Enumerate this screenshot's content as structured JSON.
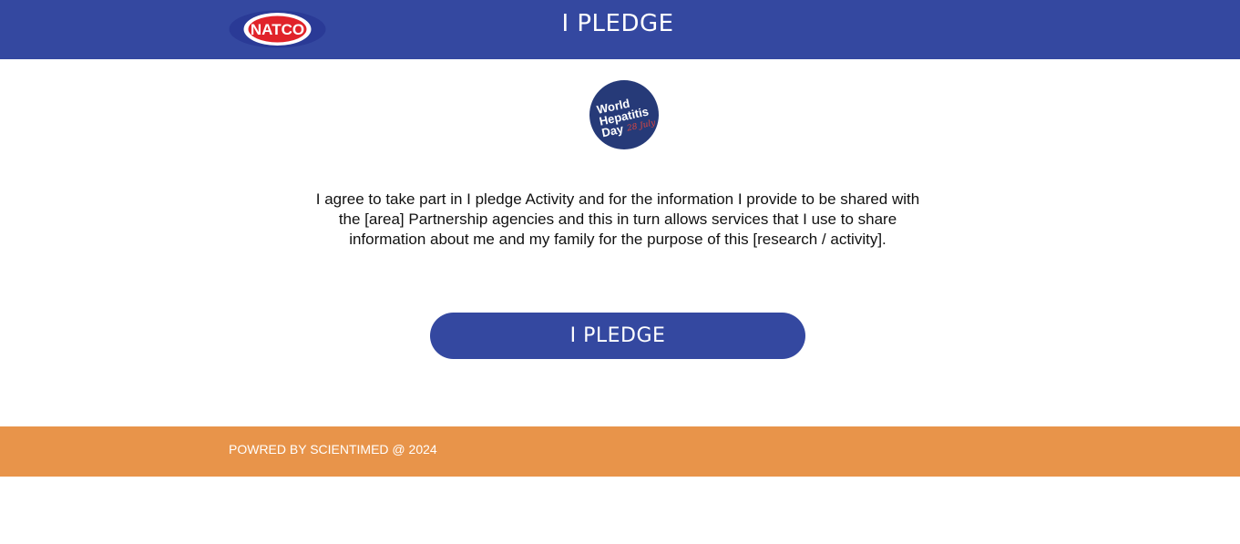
{
  "header": {
    "logo_text": "NATCO",
    "title": "I PLEDGE"
  },
  "badge": {
    "line1": "World",
    "line2": "Hepatitis",
    "line3": "Day",
    "date": "28 July"
  },
  "main": {
    "pledge_text": "I agree to take part in I pledge Activity and for the information I provide to be shared with the [area] Partnership agencies and this in turn allows services that I use to share information about me and my family for the purpose of this [research / activity].",
    "button_label": "I PLEDGE"
  },
  "footer": {
    "text": "POWRED BY SCIENTIMED @ 2024"
  },
  "colors": {
    "header_bg": "#3448a0",
    "footer_bg": "#e8944a",
    "badge_navy": "#263a78",
    "badge_arc": "#7fb6e4",
    "logo_red": "#e0232a"
  }
}
